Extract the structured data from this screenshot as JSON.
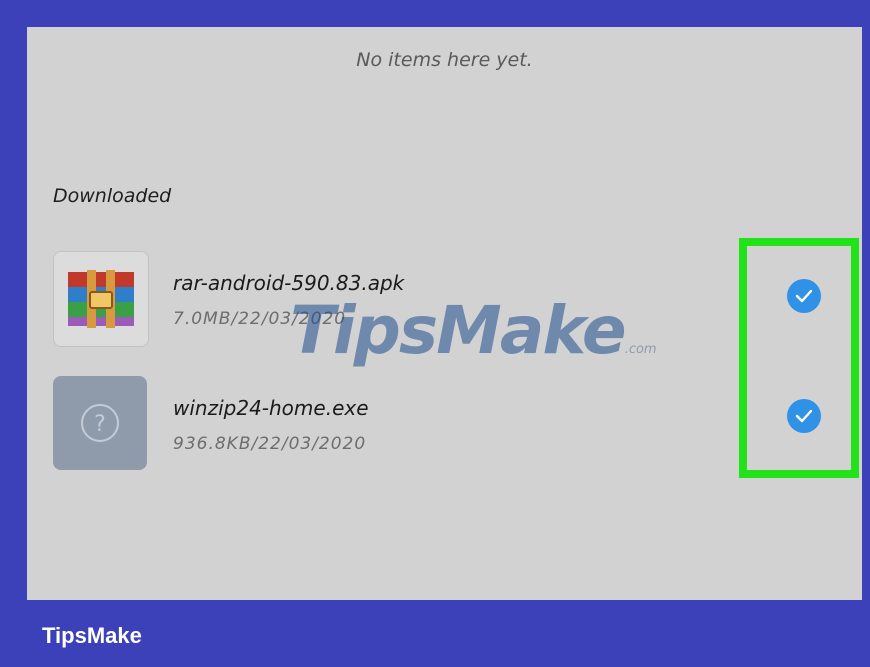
{
  "screen": {
    "empty_message": "No items here yet.",
    "section_title": "Downloaded"
  },
  "files": [
    {
      "name": "rar-android-590.83.apk",
      "meta": "7.0MB/22/03/2020",
      "icon": "winrar-archive-icon",
      "selected": true
    },
    {
      "name": "winzip24-home.exe",
      "meta": "936.8KB/22/03/2020",
      "icon": "unknown-file-icon",
      "selected": true
    }
  ],
  "watermark": {
    "text": "TipsMake",
    "suffix": ".com"
  },
  "footer": {
    "brand": "TipsMake"
  },
  "colors": {
    "frame": "#3c41b9",
    "screen": "#d2d2d2",
    "check": "#2f92e6",
    "highlight": "#22e21a"
  }
}
